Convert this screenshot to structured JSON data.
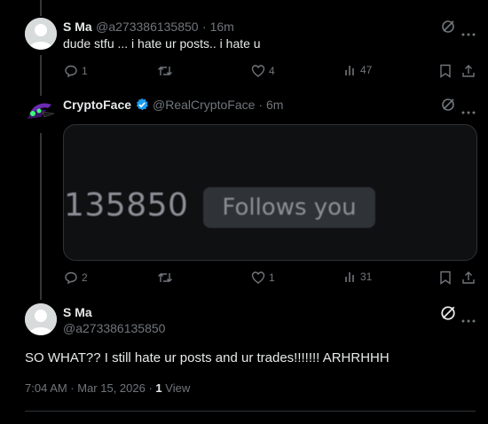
{
  "tweets": [
    {
      "name": "S Ma",
      "handle": "@a273386135850",
      "time": "· 16m",
      "text": "dude stfu ... i hate ur posts.. i hate u",
      "actions": {
        "replies": "1",
        "retweets": "",
        "likes": "4",
        "views": "47"
      }
    },
    {
      "name": "CryptoFace",
      "handle": "@RealCryptoFace",
      "time": "· 6m",
      "verified": true,
      "media": {
        "id_text": "135850",
        "badge_text": "Follows you"
      },
      "actions": {
        "replies": "2",
        "retweets": "",
        "likes": "1",
        "views": "31"
      }
    }
  ],
  "main_tweet": {
    "name": "S Ma",
    "handle": "@a273386135850",
    "text": "SO WHAT?? I still hate ur posts and ur trades!!!!!!! ARHRHHH",
    "timestamp": "7:04 AM · Mar 15, 2026 ·",
    "views_count": "1",
    "views_label": "View"
  },
  "colors": {
    "background": "#000000",
    "text": "#e7e9ea",
    "muted": "#71767b",
    "verified": "#1d9bf0"
  },
  "icons": [
    "more-icon",
    "grok-icon",
    "reply-icon",
    "retweet-icon",
    "like-icon",
    "views-icon",
    "bookmark-icon",
    "share-icon"
  ]
}
